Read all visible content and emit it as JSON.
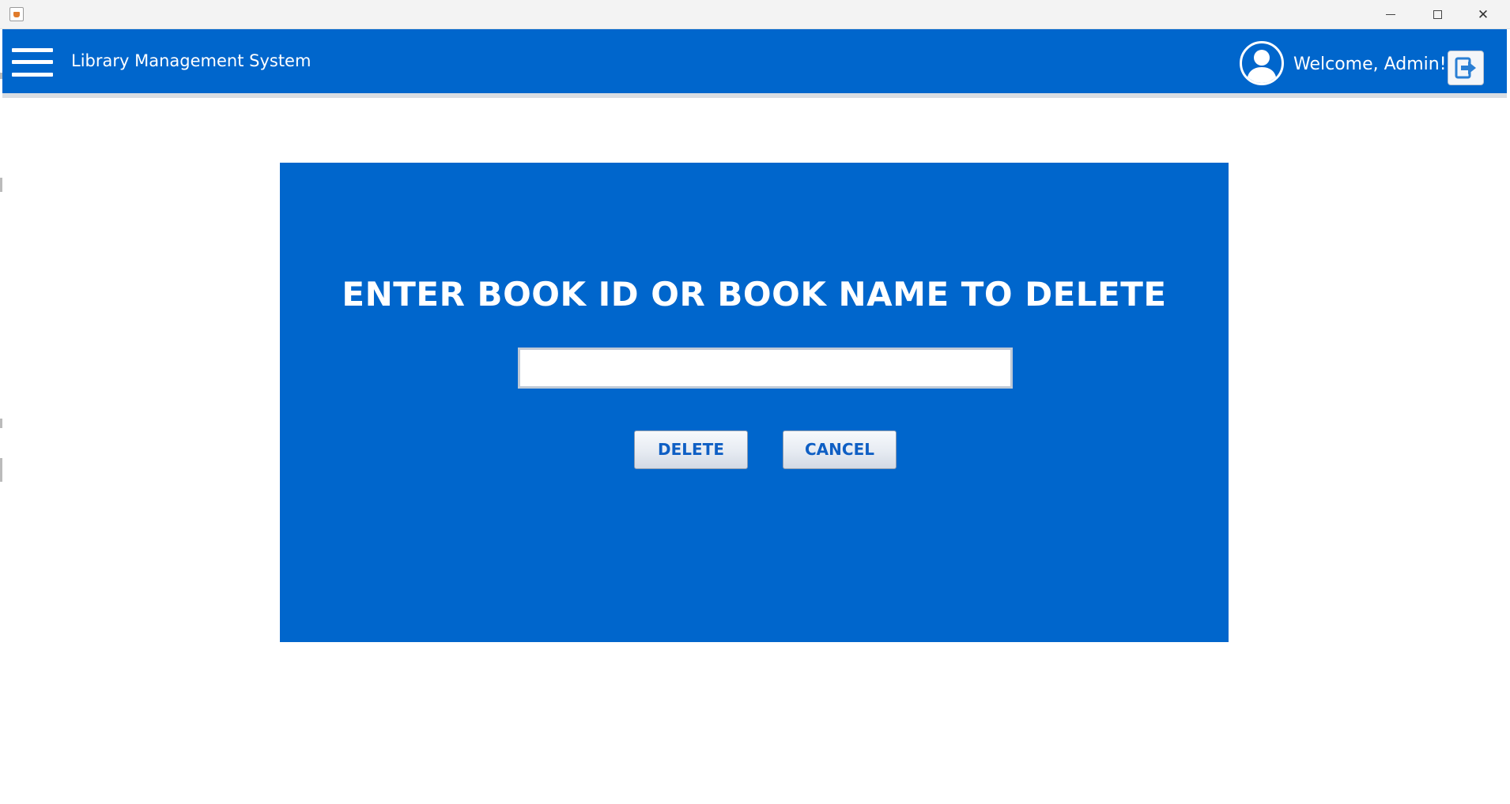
{
  "window": {
    "controls": {
      "minimize_icon": "minimize-icon",
      "maximize_icon": "maximize-icon",
      "close_glyph": "✕"
    }
  },
  "header": {
    "title": "Library Management System",
    "welcome": "Welcome, Admin!",
    "background_color": "#0066cc",
    "icons": {
      "menu": "hamburger-menu-icon",
      "avatar": "user-avatar-icon",
      "logout": "logout-icon"
    }
  },
  "delete_panel": {
    "title": "ENTER BOOK ID OR BOOK NAME TO DELETE",
    "input": {
      "value": "",
      "placeholder": ""
    },
    "buttons": {
      "delete_label": "DELETE",
      "cancel_label": "CANCEL"
    },
    "background_color": "#0066cc",
    "button_text_color": "#0f5fc4"
  }
}
